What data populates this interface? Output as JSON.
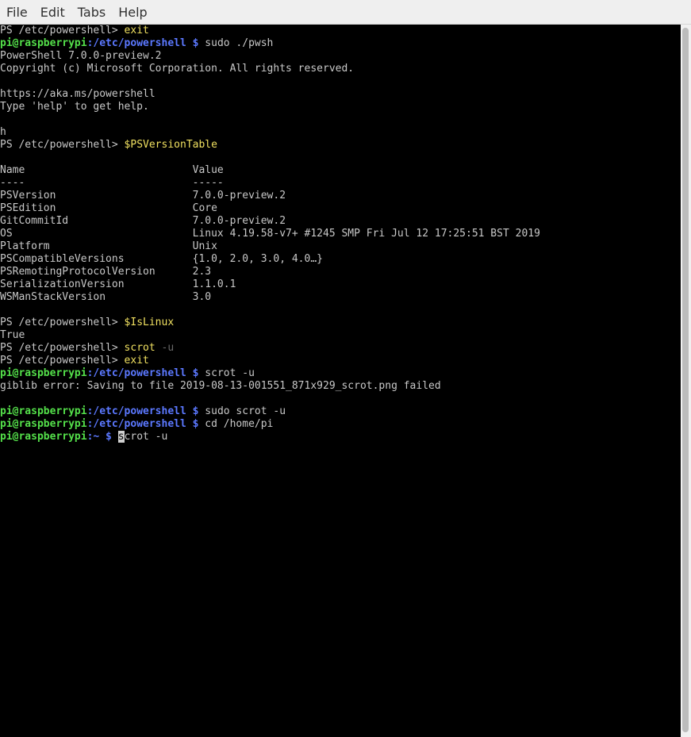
{
  "menu": [
    "File",
    "Edit",
    "Tabs",
    "Help"
  ],
  "terminal": {
    "lines": [
      [
        {
          "t": "PS /etc/powershell> ",
          "c": ""
        },
        {
          "t": "exit",
          "c": "yel"
        }
      ],
      [
        {
          "t": "pi@raspberrypi",
          "c": "user"
        },
        {
          "t": ":/etc/powershell $",
          "c": "path"
        },
        {
          "t": " sudo ./pwsh",
          "c": ""
        }
      ],
      [
        {
          "t": "PowerShell 7.0.0-preview.2",
          "c": ""
        }
      ],
      [
        {
          "t": "Copyright (c) Microsoft Corporation. All rights reserved.",
          "c": ""
        }
      ],
      [],
      [
        {
          "t": "https://aka.ms/powershell",
          "c": ""
        }
      ],
      [
        {
          "t": "Type 'help' to get help.",
          "c": ""
        }
      ],
      [],
      [
        {
          "t": "h",
          "c": ""
        }
      ],
      [
        {
          "t": "PS /etc/powershell> ",
          "c": ""
        },
        {
          "t": "$PSVersionTable",
          "c": "yel"
        }
      ],
      [],
      [
        {
          "t": "Name                           Value",
          "c": ""
        }
      ],
      [
        {
          "t": "----                           -----",
          "c": ""
        }
      ],
      [
        {
          "t": "PSVersion                      7.0.0-preview.2",
          "c": ""
        }
      ],
      [
        {
          "t": "PSEdition                      Core",
          "c": ""
        }
      ],
      [
        {
          "t": "GitCommitId                    7.0.0-preview.2",
          "c": ""
        }
      ],
      [
        {
          "t": "OS                             Linux 4.19.58-v7+ #1245 SMP Fri Jul 12 17:25:51 BST 2019",
          "c": ""
        }
      ],
      [
        {
          "t": "Platform                       Unix",
          "c": ""
        }
      ],
      [
        {
          "t": "PSCompatibleVersions           {1.0, 2.0, 3.0, 4.0…}",
          "c": ""
        }
      ],
      [
        {
          "t": "PSRemotingProtocolVersion      2.3",
          "c": ""
        }
      ],
      [
        {
          "t": "SerializationVersion           1.1.0.1",
          "c": ""
        }
      ],
      [
        {
          "t": "WSManStackVersion              3.0",
          "c": ""
        }
      ],
      [],
      [
        {
          "t": "PS /etc/powershell> ",
          "c": ""
        },
        {
          "t": "$IsLinux",
          "c": "yel"
        }
      ],
      [
        {
          "t": "True",
          "c": ""
        }
      ],
      [
        {
          "t": "PS /etc/powershell> ",
          "c": ""
        },
        {
          "t": "scrot",
          "c": "yel"
        },
        {
          "t": " -u",
          "c": "dim"
        }
      ],
      [
        {
          "t": "PS /etc/powershell> ",
          "c": ""
        },
        {
          "t": "exit",
          "c": "yel"
        }
      ],
      [
        {
          "t": "pi@raspberrypi",
          "c": "user"
        },
        {
          "t": ":/etc/powershell $",
          "c": "path"
        },
        {
          "t": " scrot -u",
          "c": ""
        }
      ],
      [
        {
          "t": "giblib error: Saving to file 2019-08-13-001551_871x929_scrot.png failed",
          "c": ""
        }
      ],
      [],
      [
        {
          "t": "pi@raspberrypi",
          "c": "user"
        },
        {
          "t": ":/etc/powershell $",
          "c": "path"
        },
        {
          "t": " sudo scrot -u",
          "c": ""
        }
      ],
      [
        {
          "t": "pi@raspberrypi",
          "c": "user"
        },
        {
          "t": ":/etc/powershell $",
          "c": "path"
        },
        {
          "t": " cd /home/pi",
          "c": ""
        }
      ],
      [
        {
          "t": "pi@raspberrypi",
          "c": "user"
        },
        {
          "t": ":~ $",
          "c": "path"
        },
        {
          "t": " ",
          "c": ""
        },
        {
          "t": "s",
          "c": "cursor"
        },
        {
          "t": "crot -u",
          "c": ""
        }
      ]
    ]
  }
}
